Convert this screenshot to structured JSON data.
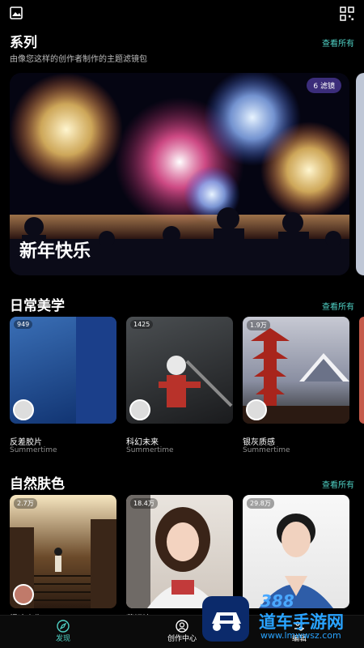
{
  "header": {
    "left_icon": "image-icon",
    "right_icon": "qr-scan-icon"
  },
  "series": {
    "title": "系列",
    "subtitle": "由像您这样的创作者制作的主题滤镜包",
    "see_all": "查看所有",
    "hero": {
      "badge": "6 滤镜",
      "title": "新年快乐"
    }
  },
  "daily": {
    "title": "日常美学",
    "see_all": "查看所有",
    "cards": [
      {
        "count": "949",
        "name": "反差胶片",
        "author": "Summertime"
      },
      {
        "count": "1425",
        "name": "科幻未来",
        "author": "Summertime"
      },
      {
        "count": "1.9万",
        "name": "银灰质感",
        "author": "Summertime"
      }
    ]
  },
  "nature": {
    "title": "自然肤色",
    "see_all": "查看所有",
    "cards": [
      {
        "count": "2.7万",
        "name": "憬迹人生"
      },
      {
        "count": "18.4万",
        "name": "蔡妍婷"
      },
      {
        "count": "29.8万",
        "name": ""
      }
    ]
  },
  "bottom_nav": {
    "items": [
      {
        "label": "发现",
        "icon": "compass-icon"
      },
      {
        "label": "创作中心",
        "icon": "user-circle-icon"
      },
      {
        "label": "编辑",
        "icon": "sliders-icon"
      }
    ]
  },
  "watermark": {
    "brand": "道车手游网",
    "url": "www.lmwwsz.com",
    "number": "388"
  },
  "colors": {
    "accent": "#4fd1c5",
    "badge_bg": "#3b2d7a"
  }
}
